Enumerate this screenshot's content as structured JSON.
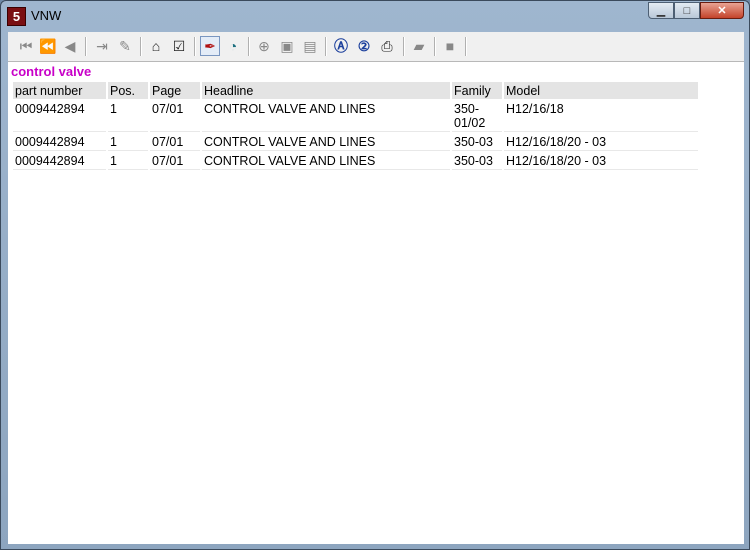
{
  "window": {
    "title": "VNW",
    "app_icon": "5"
  },
  "toolbar_icons": [
    "first-page-icon",
    "previous-chapter-icon",
    "previous-page-icon",
    "exit-icon",
    "notes-icon",
    "cart-icon",
    "checklist-icon",
    "marker-icon",
    "history-icon",
    "zoom-icon",
    "page-view-icon",
    "page-fit-icon",
    "search-a-icon",
    "search-2-icon",
    "print-icon",
    "eraser-icon",
    "stop-icon"
  ],
  "search_term": "control valve",
  "table": {
    "headers": [
      "part number",
      "Pos.",
      "Page",
      "Headline",
      "Family",
      "Model"
    ],
    "rows": [
      {
        "part_number": "0009442894",
        "pos": "1",
        "page": "07/01",
        "headline": "CONTROL VALVE AND LINES",
        "family_line1": "350-",
        "family_line2": "01/02",
        "model": "H12/16/18"
      },
      {
        "part_number": "0009442894",
        "pos": "1",
        "page": "07/01",
        "headline": "CONTROL VALVE AND LINES",
        "family": "350-03",
        "model": "H12/16/18/20 - 03"
      },
      {
        "part_number": "0009442894",
        "pos": "1",
        "page": "07/01",
        "headline": "CONTROL VALVE AND LINES",
        "family": "350-03",
        "model": "H12/16/18/20 - 03"
      }
    ]
  },
  "colors": {
    "search_term": "#c800c8",
    "headline_link": "#1a1aa6",
    "header_bg": "#e4e4e4"
  }
}
